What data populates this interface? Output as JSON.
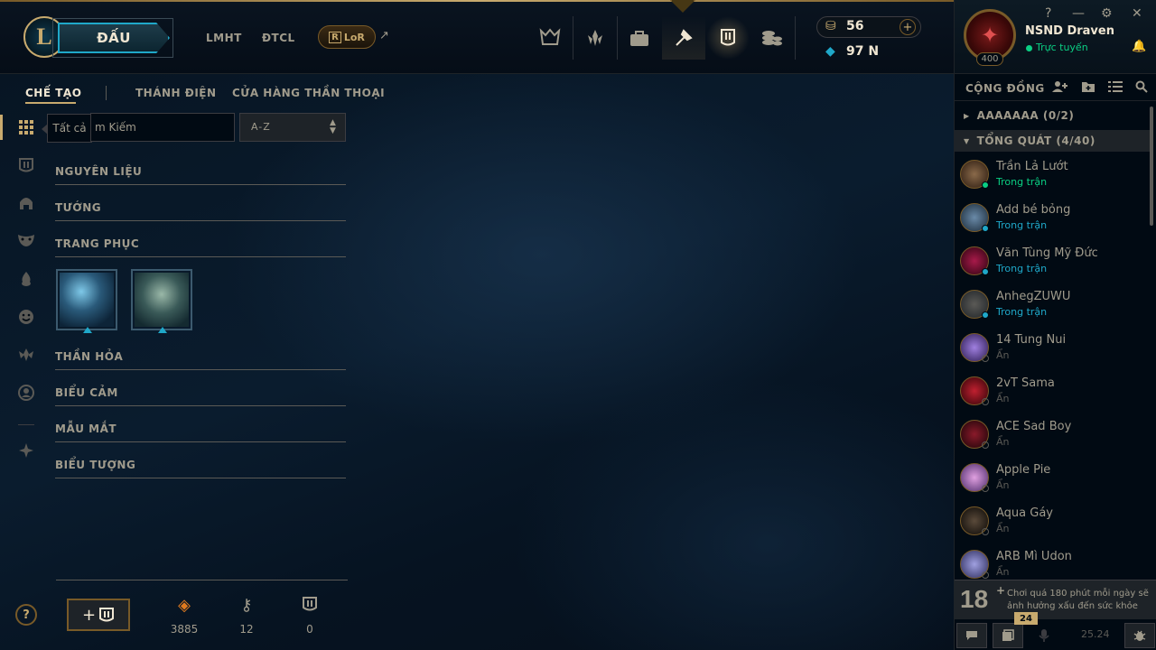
{
  "topbar": {
    "play_label": "ĐẤU",
    "nav_lmht": "LMHT",
    "nav_dtcl": "ĐTCL",
    "nav_lor": "LoR",
    "rp": "56",
    "be": "97 N"
  },
  "profile": {
    "name": "NSND Draven",
    "status": "Trực tuyến",
    "level": "400"
  },
  "subnav": {
    "items": [
      "CHẾ TẠO",
      "THÁNH ĐIỆN",
      "CỬA HÀNG THẦN THOẠI"
    ]
  },
  "filter": {
    "tooltip": "Tất cả",
    "search_placeholder": "m Kiếm",
    "sort_value": "A-Z"
  },
  "categories": [
    "NGUYÊN LIỆU",
    "TƯỚNG",
    "TRANG PHỤC",
    "THẦN HỎA",
    "BIỂU CẢM",
    "MẪU MẮT",
    "BIỂU TƯỢNG"
  ],
  "resources": {
    "orange_essence": "3885",
    "keys": "12",
    "chests": "0"
  },
  "social": {
    "title": "CỘNG ĐỒNG",
    "groups": [
      "AAAAAAA (0/2)",
      "TỔNG QUÁT (4/40)"
    ],
    "friends": [
      {
        "name": "Trần Lả Lướt",
        "status": "Trong trận",
        "color": "#0acf83"
      },
      {
        "name": "Add bé bỏng",
        "status": "Trong trận",
        "color": "#1fa8c9"
      },
      {
        "name": "Văn Tùng Mỹ Đức",
        "status": "Trong trận",
        "color": "#1fa8c9"
      },
      {
        "name": "AnhegZUWU",
        "status": "Trong trận",
        "color": "#1fa8c9"
      },
      {
        "name": "14 Tung Nui",
        "status": "Ẩn",
        "color": "#5b5a56"
      },
      {
        "name": "2vT Sama",
        "status": "Ẩn",
        "color": "#5b5a56"
      },
      {
        "name": "ACE Sad Boy",
        "status": "Ẩn",
        "color": "#5b5a56"
      },
      {
        "name": "Apple Pie",
        "status": "Ẩn",
        "color": "#5b5a56"
      },
      {
        "name": "Aqua Gáy",
        "status": "Ẩn",
        "color": "#5b5a56"
      },
      {
        "name": "ARB Mì Udon",
        "status": "Ẩn",
        "color": "#5b5a56"
      }
    ]
  },
  "notice": {
    "age": "18",
    "plus": "+",
    "text": "Chơi quá 180 phút mỗi ngày sẽ ảnh hưởng xấu đến sức khỏe"
  },
  "bottom": {
    "badge": "24",
    "patch": "25.24"
  },
  "colors": {
    "gold": "#c8aa6e",
    "cyan": "#1fa8c9",
    "online": "#0acf83"
  }
}
